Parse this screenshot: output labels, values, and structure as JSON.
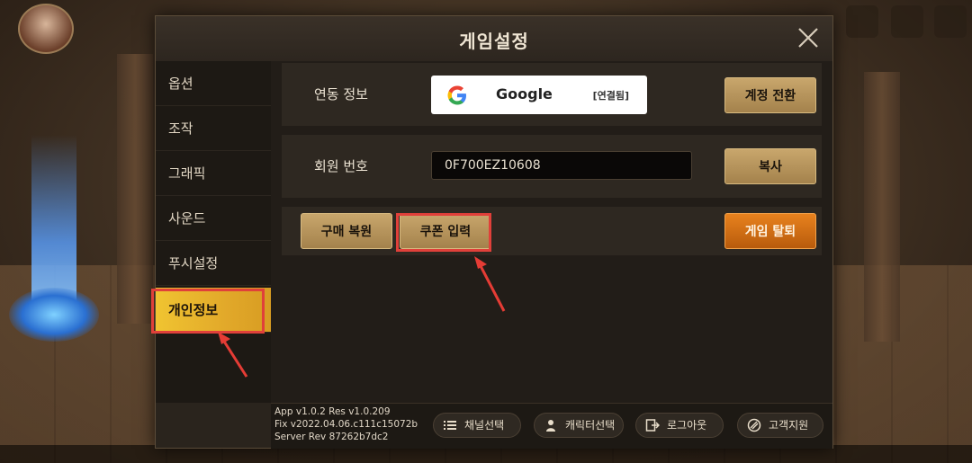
{
  "dialog": {
    "title": "게임설정",
    "close_icon": "close-icon"
  },
  "sidebar": {
    "items": [
      {
        "label": "옵션"
      },
      {
        "label": "조작"
      },
      {
        "label": "그래픽"
      },
      {
        "label": "사운드"
      },
      {
        "label": "푸시설정"
      },
      {
        "label": "개인정보"
      }
    ],
    "active_index": 5
  },
  "link_info": {
    "label": "연동 정보",
    "provider": "Google",
    "status": "[연결됨]",
    "switch_button": "계정 전환"
  },
  "member": {
    "label": "회원 번호",
    "value": "0F700EZ10608",
    "copy_button": "복사"
  },
  "actions": {
    "restore_purchase": "구매 복원",
    "coupon_input": "쿠폰 입력",
    "withdraw": "게임 탈퇴"
  },
  "footer": {
    "version_line1": "App v1.0.2 Res v1.0.209",
    "version_line2": "Fix v2022.04.06.c111c15072b",
    "version_line3": "Server Rev 87262b7dc2",
    "buttons": [
      {
        "label": "채널선택",
        "icon": "list-icon"
      },
      {
        "label": "캐릭터선택",
        "icon": "person-icon"
      },
      {
        "label": "로그아웃",
        "icon": "logout-icon"
      },
      {
        "label": "고객지원",
        "icon": "support-icon"
      }
    ]
  },
  "colors": {
    "active_tab": "#f0c431",
    "highlight": "#e0403a",
    "gold_button": "#b8965c",
    "orange_button": "#d8701a"
  }
}
